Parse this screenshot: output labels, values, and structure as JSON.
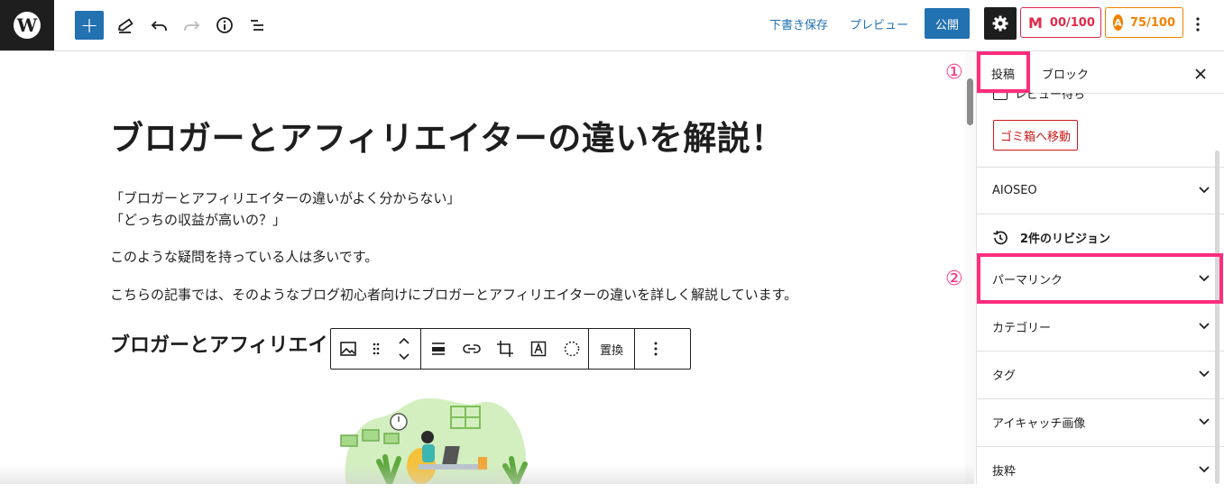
{
  "toolbar": {
    "logo_glyph": "W",
    "add_label": "+",
    "draft_save": "下書き保存",
    "preview": "プレビュー",
    "publish": "公開",
    "score_red": "00/100",
    "score_orange": "75/100",
    "score_red_mark": "M",
    "score_orange_mark": "A",
    "icons": [
      "pencil-icon",
      "undo-icon",
      "redo-icon",
      "info-icon",
      "list-view-icon",
      "gear-icon",
      "more-vertical-icon"
    ]
  },
  "editor": {
    "title": "ブロガーとアフィリエイターの違いを解説！",
    "quote_line1": "「ブロガーとアフィリエイターの違いがよく分からない」",
    "quote_line2": "「どっちの収益が高いの？」",
    "para1": "このような疑問を持っている人は多いです。",
    "para2": "こちらの記事では、そのようなブログ初心者向けにブロガーとアフィリエイターの違いを詳しく解説しています。",
    "heading2": "ブロガーとアフィリエイ",
    "block_toolbar": {
      "replace": "置換",
      "icons": [
        "image-icon",
        "drag-handle-icon",
        "move-up-down-icon",
        "align-icon",
        "link-icon",
        "crop-icon",
        "text-overlay-icon",
        "duotone-icon",
        "more-vertical-icon"
      ]
    }
  },
  "sidebar": {
    "tab_post": "投稿",
    "tab_block": "ブロック",
    "close": "×",
    "pending_label": "レビュー待ち",
    "trash": "ゴミ箱へ移動",
    "panels": [
      "AIOSEO",
      "2件のリビジョン",
      "パーマリンク",
      "カテゴリー",
      "タグ",
      "アイキャッチ画像",
      "抜粋"
    ]
  },
  "annotations": {
    "marker1": "①",
    "marker2": "②",
    "color": "#ff2d7d"
  },
  "colors": {
    "accent": "#2271b1",
    "danger": "#cc1818"
  }
}
